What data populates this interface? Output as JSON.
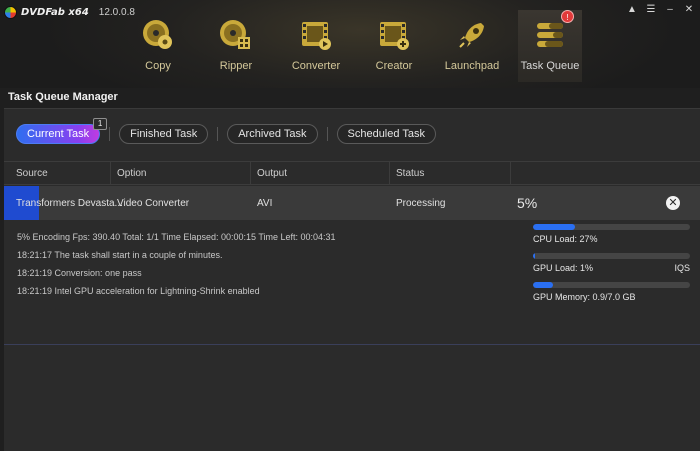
{
  "app": {
    "brand": "DVDFab x64",
    "version": "12.0.0.8",
    "window_controls": [
      "pin",
      "menu",
      "minimize",
      "close"
    ]
  },
  "nav": [
    {
      "label": "Copy",
      "icon": "copy-disc-icon"
    },
    {
      "label": "Ripper",
      "icon": "ripper-disc-icon"
    },
    {
      "label": "Converter",
      "icon": "converter-film-icon"
    },
    {
      "label": "Creator",
      "icon": "creator-film-icon"
    },
    {
      "label": "Launchpad",
      "icon": "rocket-icon"
    },
    {
      "label": "Task Queue",
      "icon": "task-queue-icon",
      "active": true,
      "badge": "!"
    }
  ],
  "section_title": "Task Queue Manager",
  "tabs": [
    {
      "label": "Current Task",
      "count": "1",
      "active": true
    },
    {
      "label": "Finished Task"
    },
    {
      "label": "Archived Task"
    },
    {
      "label": "Scheduled Task"
    }
  ],
  "table": {
    "columns": [
      "Source",
      "Option",
      "Output",
      "Status"
    ],
    "row": {
      "source": "Transformers Devasta...",
      "option": "Video Converter",
      "output": "AVI",
      "status": "Processing",
      "percent_text": "5%",
      "progress": 0.05
    }
  },
  "log": [
    "5%  Encoding Fps: 390.40   Total: 1/1  Time Elapsed: 00:00:15  Time Left: 00:04:31",
    "18:21:17  The task shall start in a couple of minutes.",
    "18:21:19  Conversion: one pass",
    "18:21:19  Intel GPU acceleration for Lightning-Shrink enabled"
  ],
  "stats": {
    "cpu": {
      "label": "CPU Load: 27%",
      "value": 0.27
    },
    "gpu": {
      "label": "GPU Load: 1%",
      "value": 0.01,
      "extra": "IQS"
    },
    "gpu_mem": {
      "label": "GPU Memory: 0.9/7.0 GB",
      "value": 0.13
    }
  },
  "colors": {
    "accent": "#2a6ff2",
    "progress": "#1f4bd0",
    "badge": "#e33a3a",
    "nav_label": "#d4c89a"
  }
}
